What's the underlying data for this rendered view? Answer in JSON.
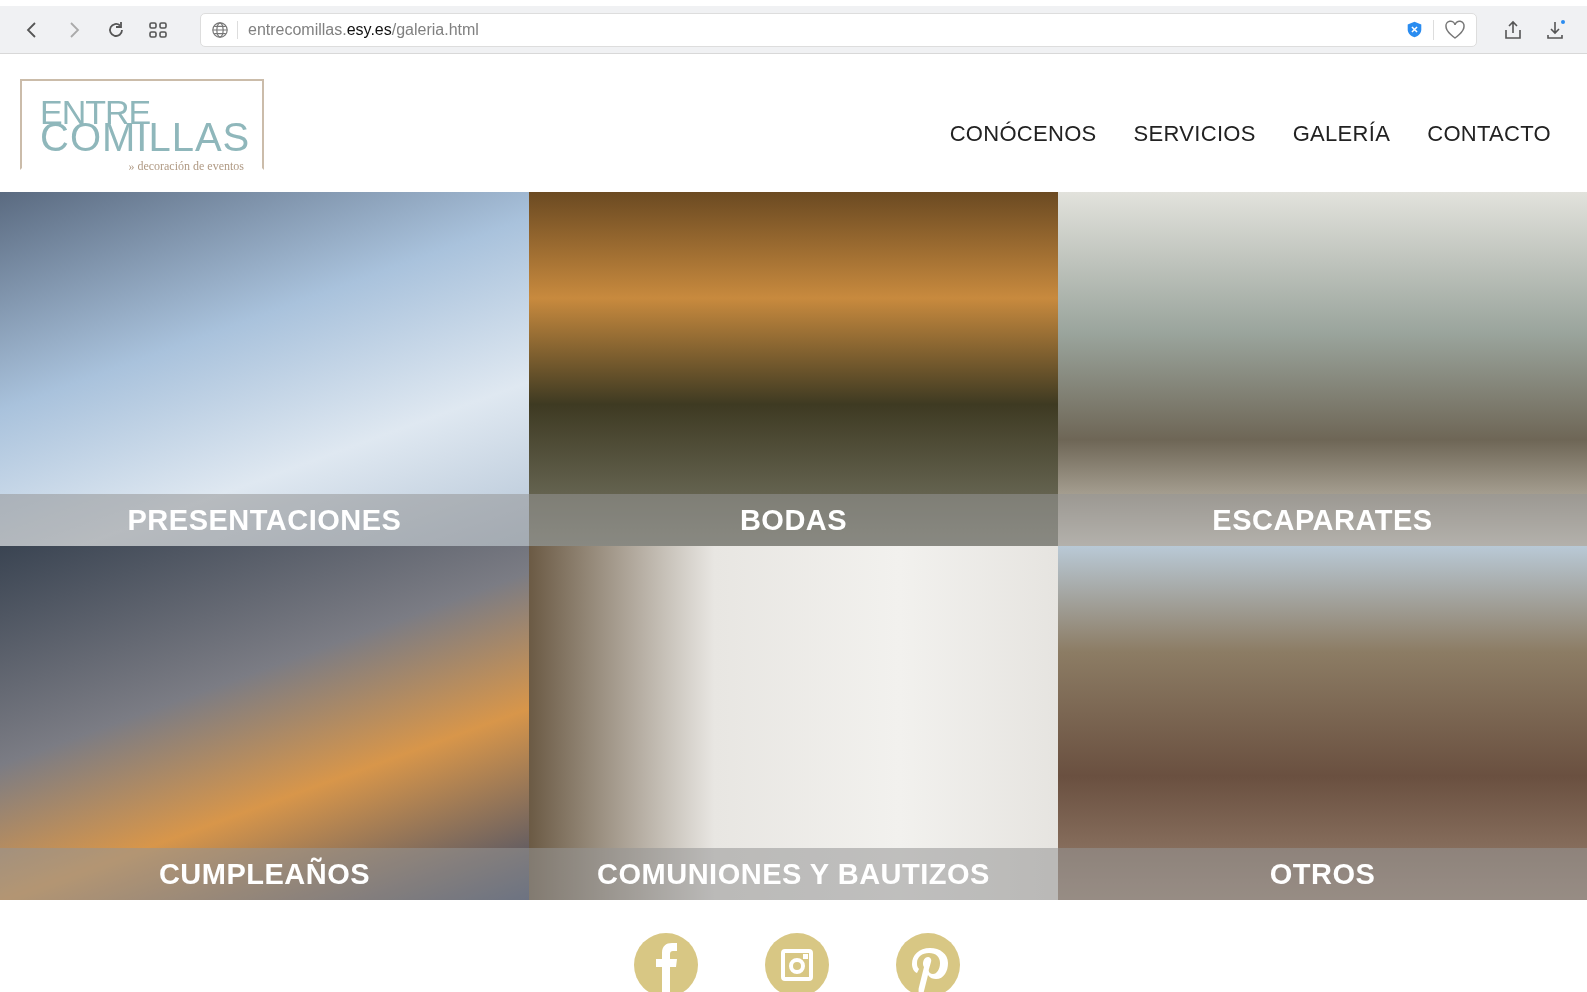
{
  "browser": {
    "url": "entrecomillas.**esy.es**/galeria.html"
  },
  "logo": {
    "line_1": "ENTRE",
    "line_2": "COMILLAS",
    "tagline": "» decoración de eventos"
  },
  "nav": [
    {
      "label": "CONÓCENOS"
    },
    {
      "label": "SERVICIOS"
    },
    {
      "label": "GALERÍA"
    },
    {
      "label": "CONTACTO"
    }
  ],
  "gallery": [
    {
      "caption": "PRESENTACIONES"
    },
    {
      "caption": "BODAS"
    },
    {
      "caption": "ESCAPARATES"
    },
    {
      "caption": "CUMPLEAÑOS"
    },
    {
      "caption": "COMUNIONES Y BAUTIZOS"
    },
    {
      "caption": "OTROS"
    }
  ],
  "social": [
    {
      "kind": "facebook"
    },
    {
      "kind": "instagram"
    },
    {
      "kind": "pinterest"
    }
  ]
}
